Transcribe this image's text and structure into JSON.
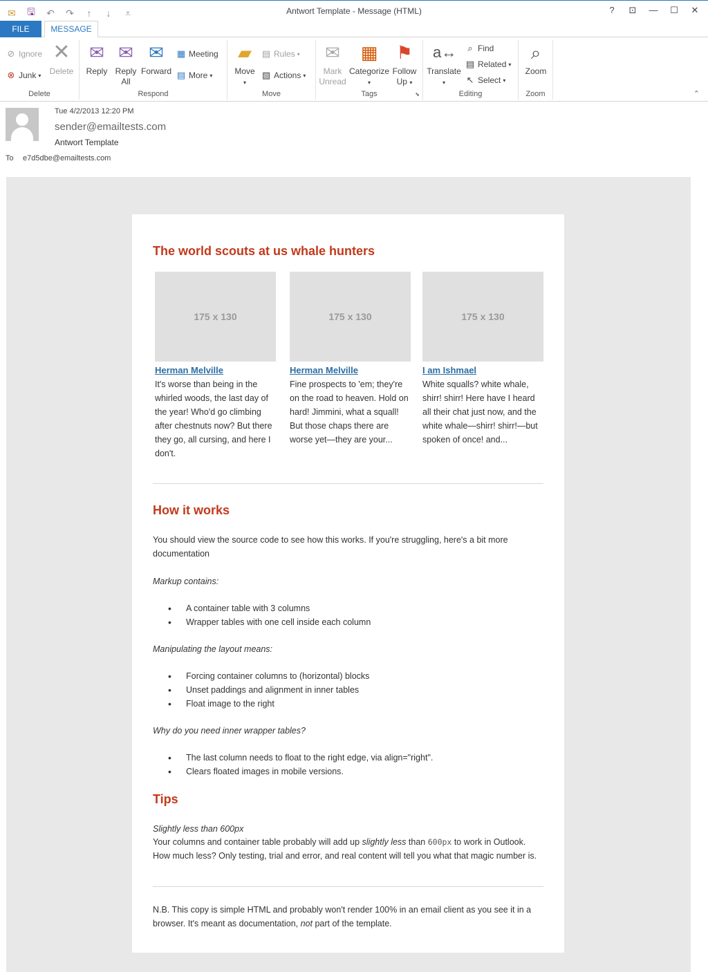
{
  "window": {
    "title": "Antwort Template - Message (HTML)",
    "help": "?",
    "restore_ribbon": "⊡",
    "minimize": "—",
    "maximize": "☐",
    "close": "✕"
  },
  "qat": {
    "save": "🖫",
    "undo": "↶",
    "redo": "↷",
    "up": "↑",
    "down": "↓",
    "customize": "⩡"
  },
  "tabs": {
    "file": "FILE",
    "message": "MESSAGE"
  },
  "ribbon": {
    "delete": {
      "label": "Delete",
      "ignore": "Ignore",
      "junk": "Junk",
      "delete": "Delete"
    },
    "respond": {
      "label": "Respond",
      "reply": "Reply",
      "reply_all_1": "Reply",
      "reply_all_2": "All",
      "forward": "Forward",
      "meeting": "Meeting",
      "more": "More"
    },
    "move": {
      "label": "Move",
      "move": "Move",
      "rules": "Rules",
      "actions": "Actions"
    },
    "tags": {
      "label": "Tags",
      "mark_unread_1": "Mark",
      "mark_unread_2": "Unread",
      "categorize": "Categorize",
      "follow_up_1": "Follow",
      "follow_up_2": "Up"
    },
    "editing": {
      "label": "Editing",
      "translate": "Translate",
      "find": "Find",
      "related": "Related",
      "select": "Select"
    },
    "zoom": {
      "label": "Zoom",
      "zoom": "Zoom"
    }
  },
  "message": {
    "date": "Tue 4/2/2013 12:20 PM",
    "sender": "sender@emailtests.com",
    "subject": "Antwort Template",
    "to_label": "To",
    "to": "e7d5dbe@emailtests.com"
  },
  "email": {
    "heading1": "The world scouts at us whale hunters",
    "columns": [
      {
        "image": "175 x 130",
        "link": "Herman Melville",
        "text": "It's worse than being in the whirled woods, the last day of the year! Who'd go climbing after chestnuts now? But there they go, all cursing, and here I don't."
      },
      {
        "image": "175 x 130",
        "link": "Herman Melville",
        "text": "Fine prospects to 'em; they're on the road to heaven. Hold on hard! Jimmini, what a squall! But those chaps there are worse yet—they are your..."
      },
      {
        "image": "175 x 130",
        "link": "I am Ishmael",
        "text": "White squalls? white whale, shirr! shirr! Here have I heard all their chat just now, and the white whale—shirr! shirr!—but spoken of once! and..."
      }
    ],
    "heading2": "How it works",
    "intro": "You should view the source code to see how this works. If you're struggling, here's a bit more documentation",
    "markup_title": "Markup contains:",
    "markup_items": [
      "A container table with 3 columns",
      "Wrapper tables with one cell inside each column"
    ],
    "layout_title": "Manipulating the layout means:",
    "layout_items": [
      "Forcing container columns to (horizontal) blocks",
      "Unset paddings and alignment in inner tables",
      "Float image to the right"
    ],
    "why_title": "Why do you need inner wrapper tables?",
    "why_items": [
      "The last column needs to float to the right edge, via align=\"right\".",
      "Clears floated images in mobile versions."
    ],
    "heading3": "Tips",
    "tip_title": "Slightly less than 600px",
    "tip_a": "Your columns and container table probably will add up ",
    "tip_em": "slightly less",
    "tip_b": " than ",
    "tip_code": "600px",
    "tip_c": " to work in Outlook. How much less? Only testing, trial and error, and real content will tell you what that magic number is.",
    "nb_a": "N.B. This copy is simple HTML and probably won't render 100% in an email client as you see it in a browser. It's meant as documentation, ",
    "nb_em": "not",
    "nb_b": " part of the template."
  }
}
